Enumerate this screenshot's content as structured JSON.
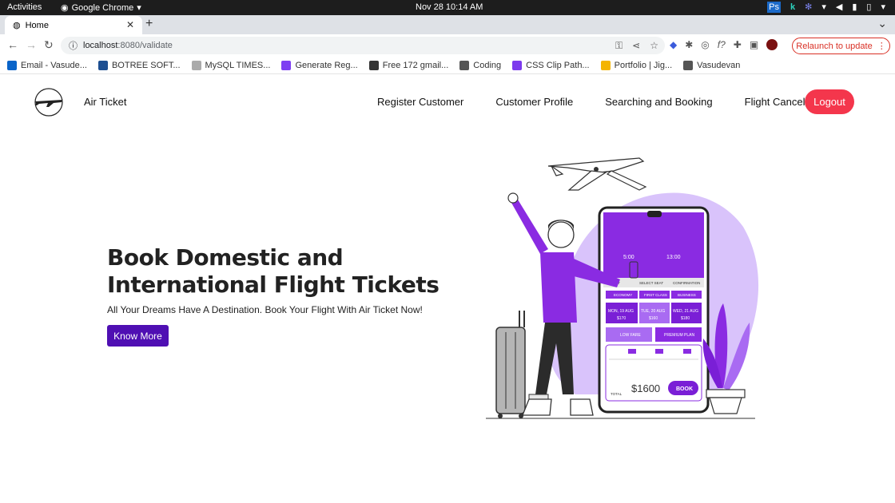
{
  "os": {
    "activities": "Activities",
    "app_name": "Google Chrome",
    "clock": "Nov 28  10:14 AM"
  },
  "browser": {
    "tab_title": "Home",
    "url_host": "localhost",
    "url_path": ":8080/validate",
    "relaunch_label": "Relaunch to update",
    "bookmarks": [
      {
        "label": "Email - Vasude...",
        "icon": "outlook-icon",
        "color": "#0a64c9"
      },
      {
        "label": "BOTREE SOFT...",
        "icon": "d-icon",
        "color": "#1d4f91"
      },
      {
        "label": "MySQL TIMES...",
        "icon": "w3-icon",
        "color": "#aaaaaa"
      },
      {
        "label": "Generate Reg...",
        "icon": "bolt-icon",
        "color": "#7e3ff2"
      },
      {
        "label": "Free 172 gmail...",
        "icon": "rocket-icon",
        "color": "#333333"
      },
      {
        "label": "Coding",
        "icon": "folder-icon",
        "color": "#555555"
      },
      {
        "label": "CSS Clip Path...",
        "icon": "hexagon-icon",
        "color": "#7c3aed"
      },
      {
        "label": "Portfolio | Jig...",
        "icon": "chart-icon",
        "color": "#f4b400"
      },
      {
        "label": "Vasudevan",
        "icon": "globe-icon",
        "color": "#555555"
      }
    ]
  },
  "site": {
    "brand": "Air Ticket",
    "nav": [
      "Register Customer",
      "Customer Profile",
      "Searching and Booking",
      "Flight Cancellation"
    ],
    "logout": "Logout",
    "colors": {
      "logout": "#f4364c",
      "cta": "#4f0fb3",
      "accent": "#8a2be2"
    }
  },
  "hero": {
    "title": "Book Domestic and International Flight Tickets",
    "subtitle": "All Your Dreams Have A Destination. Book Your Flight With Air Ticket Now!",
    "cta": "Know More"
  },
  "illustration": {
    "time_depart": "5:00",
    "time_arrive": "13:00",
    "tab_flight": "FLIGHT",
    "tab_seat": "SELECT SEAT",
    "tab_confirm": "CONFIRMATION",
    "class_economy": "ECONOMY",
    "class_first": "FIRST CLASS",
    "class_business": "BUSINESS",
    "date1": "MON, 19 AUG",
    "price1": "$170",
    "date2": "TUE, 20 AUG",
    "price2": "$160",
    "date3": "WED, 21 AUG",
    "price3": "$180",
    "plan_low": "LOW FARE",
    "plan_premium": "PREMIUM PLAN",
    "total_label": "TOTAL",
    "total": "$1600",
    "book": "BOOK"
  }
}
